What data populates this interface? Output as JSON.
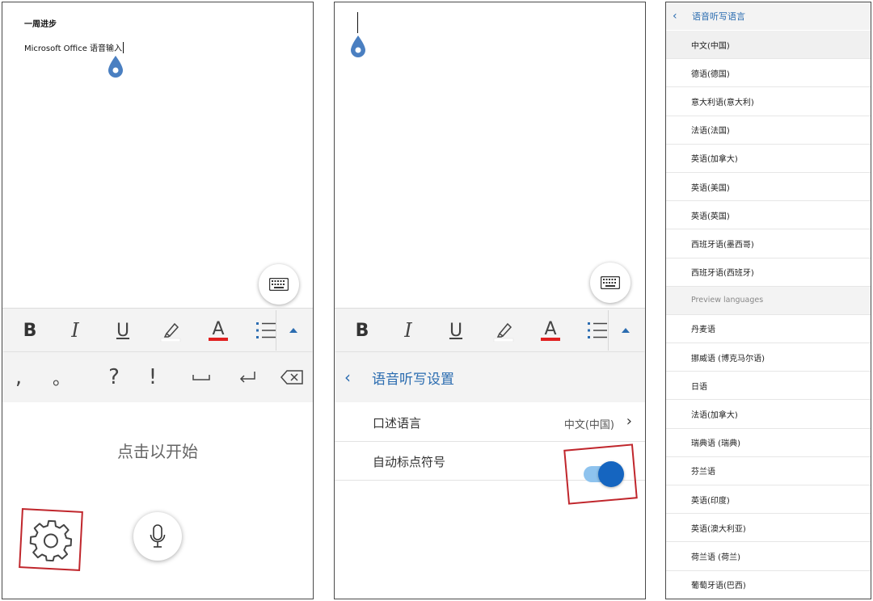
{
  "panel1": {
    "doc_title": "一周进步",
    "doc_line": "Microsoft Office 语音输入",
    "toolbar": {
      "bold": "B",
      "italic": "I",
      "underline": "U",
      "highlight_color": "#ffffff",
      "font_color": "#e02020"
    },
    "punctuation": [
      ",",
      "。",
      "?",
      "!"
    ],
    "start_text": "点击以开始"
  },
  "panel2": {
    "settings_title": "语音听写设置",
    "rows": [
      {
        "label": "口述语言",
        "value": "中文(中国)"
      },
      {
        "label": "自动标点符号"
      }
    ],
    "auto_punctuation_enabled": true
  },
  "panel3": {
    "title": "语音听写语言",
    "languages": [
      {
        "label": "中文(中国)",
        "selected": true
      },
      {
        "label": "德语(德国)"
      },
      {
        "label": "意大利语(意大利)"
      },
      {
        "label": "法语(法国)"
      },
      {
        "label": "英语(加拿大)"
      },
      {
        "label": "英语(美国)"
      },
      {
        "label": "英语(英国)"
      },
      {
        "label": "西班牙语(墨西哥)"
      },
      {
        "label": "西班牙语(西班牙)"
      },
      {
        "label": "Preview languages",
        "section": true
      },
      {
        "label": "丹麦语"
      },
      {
        "label": "挪威语 (博克马尔语)"
      },
      {
        "label": "日语"
      },
      {
        "label": "法语(加拿大)"
      },
      {
        "label": "瑞典语 (瑞典)"
      },
      {
        "label": "芬兰语"
      },
      {
        "label": "英语(印度)"
      },
      {
        "label": "英语(澳大利亚)"
      },
      {
        "label": "荷兰语 (荷兰)"
      },
      {
        "label": "葡萄牙语(巴西)"
      }
    ]
  },
  "colors": {
    "accent": "#2b6cb0",
    "annotation_red": "#c0262c",
    "toggle_on": "#1565c0",
    "drop_blue": "#4a7fc1"
  }
}
